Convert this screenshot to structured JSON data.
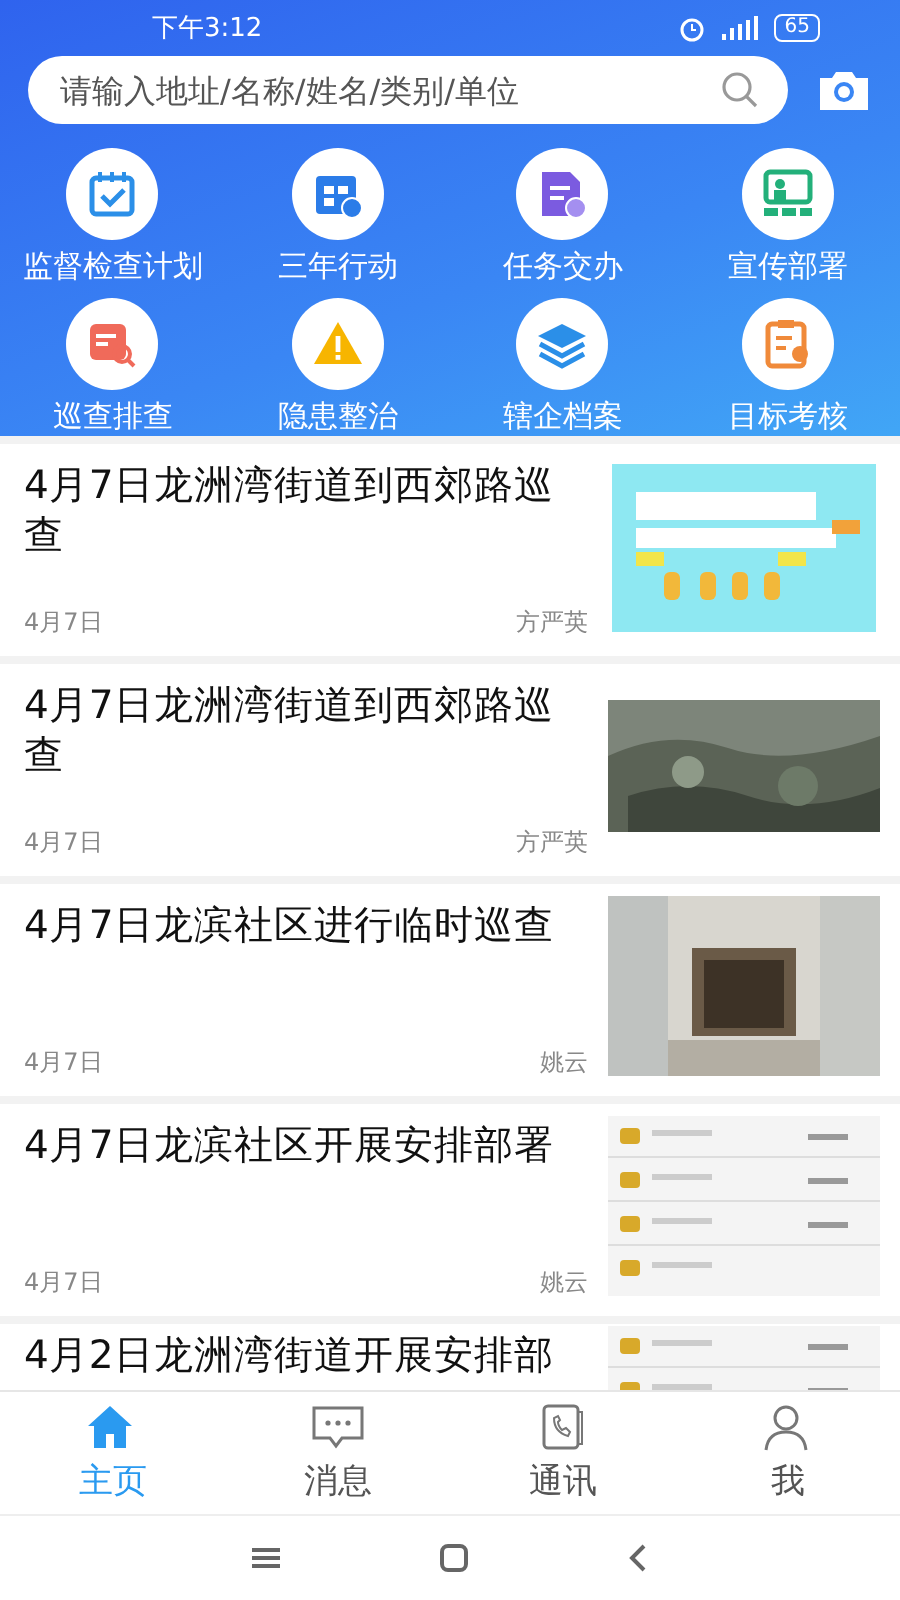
{
  "status_bar": {
    "time": "下午3:12",
    "battery": "65"
  },
  "search": {
    "placeholder": "请输入地址/名称/姓名/类别/单位"
  },
  "shortcuts": [
    {
      "label": "监督检查计划",
      "kind": "calendar-check"
    },
    {
      "label": "三年行动",
      "kind": "calendar"
    },
    {
      "label": "任务交办",
      "kind": "document-person"
    },
    {
      "label": "宣传部署",
      "kind": "board"
    },
    {
      "label": "巡查排查",
      "kind": "search-doc"
    },
    {
      "label": "隐患整治",
      "kind": "warning"
    },
    {
      "label": "辖企档案",
      "kind": "layers"
    },
    {
      "label": "目标考核",
      "kind": "clipboard"
    }
  ],
  "news": [
    {
      "title": "4月7日龙洲湾街道到西郊路巡查",
      "date": "4月7日",
      "author": "方严英",
      "thumbnail": {
        "kind": "diagram"
      }
    },
    {
      "title": "4月7日龙洲湾街道到西郊路巡查",
      "date": "4月7日",
      "author": "方严英",
      "thumbnail": {
        "kind": "photo-ground"
      }
    },
    {
      "title": "4月7日龙滨社区进行临时巡查",
      "date": "4月7日",
      "author": "姚云",
      "thumbnail": {
        "kind": "photo-room"
      }
    },
    {
      "title": "4月7日龙滨社区开展安排部署",
      "date": "4月7日",
      "author": "姚云",
      "thumbnail": {
        "kind": "list-screen"
      }
    },
    {
      "title": "4月2日龙洲湾街道开展安排部",
      "thumbnail": {
        "kind": "list-screen"
      }
    }
  ],
  "tabs": [
    {
      "label": "主页",
      "kind": "home",
      "selected": true
    },
    {
      "label": "消息",
      "kind": "chat",
      "selected": false
    },
    {
      "label": "通讯",
      "kind": "phone",
      "selected": false
    },
    {
      "label": "我",
      "kind": "person",
      "selected": false
    }
  ]
}
